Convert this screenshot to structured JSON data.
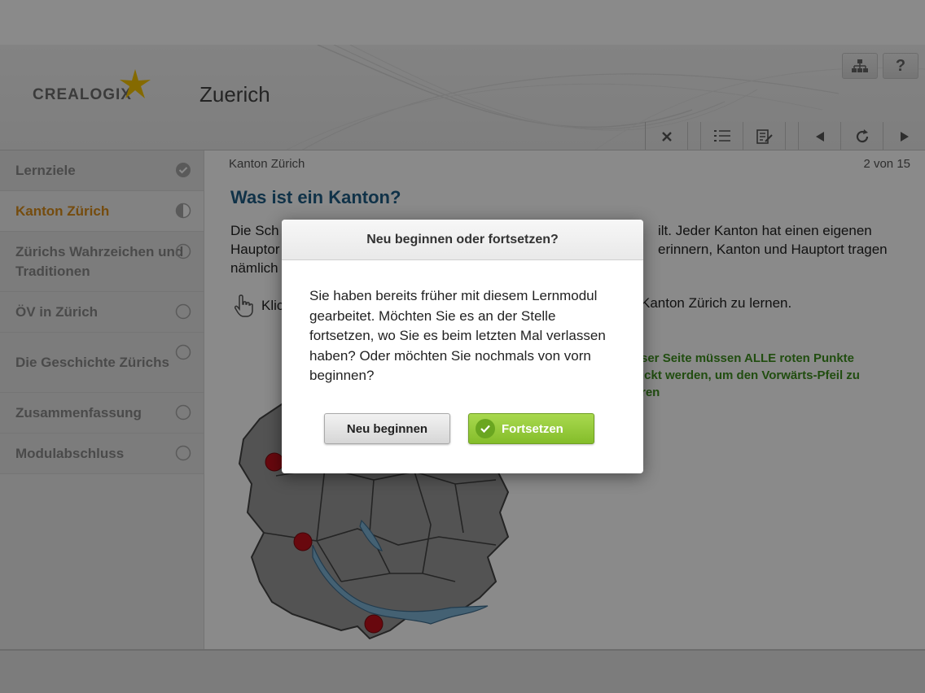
{
  "app": {
    "logo_text": "CREALOGIX",
    "title": "Zuerich"
  },
  "top_icons": [
    {
      "name": "sitemap-icon"
    },
    {
      "name": "help-icon",
      "label": "?"
    }
  ],
  "toolbar": {
    "buttons": [
      "close-icon",
      "list-icon",
      "notes-icon",
      "prev-icon",
      "reload-icon",
      "next-icon"
    ]
  },
  "sidebar": {
    "items": [
      {
        "label": "Lernziele",
        "status": "done"
      },
      {
        "label": "Kanton Zürich",
        "status": "in-progress"
      },
      {
        "label": "Zürichs Wahrzeichen und Traditionen",
        "status": "open"
      },
      {
        "label": "ÖV in Zürich",
        "status": "open"
      },
      {
        "label": "Die Geschichte Zürichs",
        "status": "open"
      },
      {
        "label": "Zusammenfassung",
        "status": "open"
      },
      {
        "label": "Modulabschluss",
        "status": "open"
      }
    ]
  },
  "content": {
    "breadcrumb": "Kanton Zürich",
    "pager": "2 von 15",
    "heading": "Was ist ein Kanton?",
    "paragraph_line1_left": "Die Sch",
    "paragraph_line1_right": "ilt. Jeder Kanton hat einen eigenen",
    "paragraph_line2_left": "Hauptor",
    "paragraph_line2_right": "erinnern, Kanton und Hauptort tragen",
    "paragraph_line3_left": "nämlich",
    "hint_left": "Klic",
    "hint_right": "Kanton Zürich zu lernen.",
    "note_line1": "ser Seite müssen ALLE roten Punkte",
    "note_line2": "ickt werden, um den Vorwärts-Pfeil zu",
    "note_line3": "ren"
  },
  "dialog": {
    "title": "Neu beginnen oder fortsetzen?",
    "message": "Sie haben bereits früher mit diesem Lernmodul gearbeitet. Möchten Sie es an der Stelle fortsetzen, wo Sie es beim letzten Mal verlassen haben? Oder möchten Sie nochmals von vorn beginnen?",
    "restart_label": "Neu beginnen",
    "continue_label": "Fortsetzen"
  },
  "colors": {
    "accent_orange": "#d98c1a",
    "heading_blue": "#1f5d86",
    "green_note": "#3d8f1f",
    "button_green": "#8cc63f",
    "map_red_dot": "#c0101a",
    "lake_blue": "#7fb3d5"
  }
}
